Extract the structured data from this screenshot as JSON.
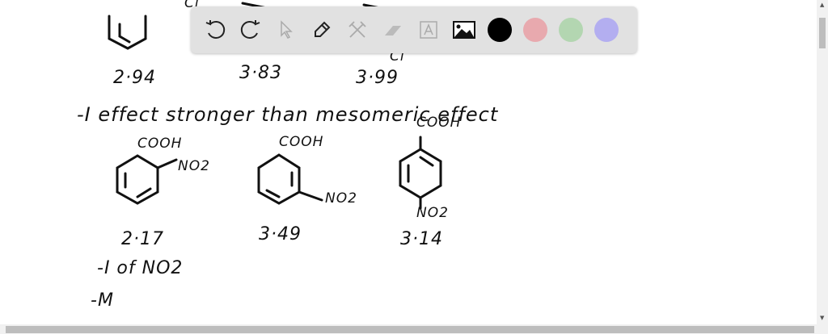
{
  "toolbar": {
    "tools": [
      "undo-icon",
      "redo-icon",
      "pointer-icon",
      "pen-icon",
      "tools-icon",
      "eraser-icon",
      "text-icon",
      "image-icon"
    ],
    "colors": [
      "#000000",
      "#e8a9ae",
      "#b3d6b1",
      "#b3aef0"
    ]
  },
  "board": {
    "top_labels": [
      "Cl",
      "Cl"
    ],
    "pka_row1": [
      "2·94",
      "3·83",
      "3·99"
    ],
    "note1": "-I effect stronger than mesomeric effect",
    "mol": [
      {
        "sub1": "COOH",
        "sub2": "NO2",
        "pka": "2·17"
      },
      {
        "sub1": "COOH",
        "sub2": "NO2",
        "pka": "3·49"
      },
      {
        "sub1": "COOH",
        "sub2": "NO2",
        "pka": "3·14"
      }
    ],
    "note2": "-I of NO2",
    "note3": "-M"
  }
}
